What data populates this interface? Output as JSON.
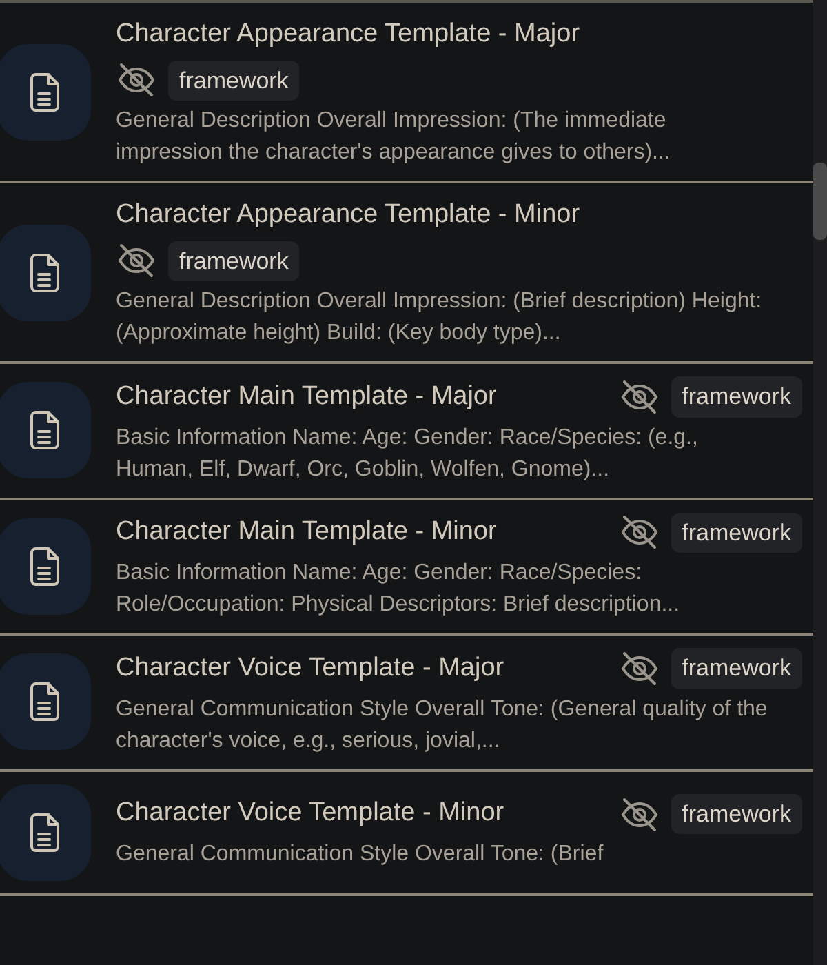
{
  "items": [
    {
      "kind": "stacked",
      "title": "Character Appearance Template - Major",
      "hidden": true,
      "tag": "framework",
      "description": "General Description Overall Impression: (The immediate impression the character's appearance gives to others)..."
    },
    {
      "kind": "stacked",
      "title": "Character Appearance Template - Minor",
      "hidden": true,
      "tag": "framework",
      "description": "General Description Overall Impression: (Brief description) Height: (Approximate height) Build: (Key body type)..."
    },
    {
      "kind": "inline",
      "title": "Character Main Template - Major",
      "hidden": true,
      "tag": "framework",
      "description": "Basic Information Name: Age: Gender: Race/Species: (e.g., Human, Elf, Dwarf, Orc, Goblin, Wolfen, Gnome)..."
    },
    {
      "kind": "inline",
      "title": "Character Main Template - Minor",
      "hidden": true,
      "tag": "framework",
      "description": "Basic Information Name: Age: Gender: Race/Species: Role/Occupation: Physical Descriptors: Brief description..."
    },
    {
      "kind": "inline",
      "title": "Character Voice Template - Major",
      "hidden": true,
      "tag": "framework",
      "description": "General Communication Style Overall Tone: (General quality of the character's voice, e.g., serious, jovial,..."
    },
    {
      "kind": "inline",
      "title": "Character Voice Template - Minor",
      "hidden": true,
      "tag": "framework",
      "description": "General Communication Style Overall Tone: (Brief"
    }
  ]
}
